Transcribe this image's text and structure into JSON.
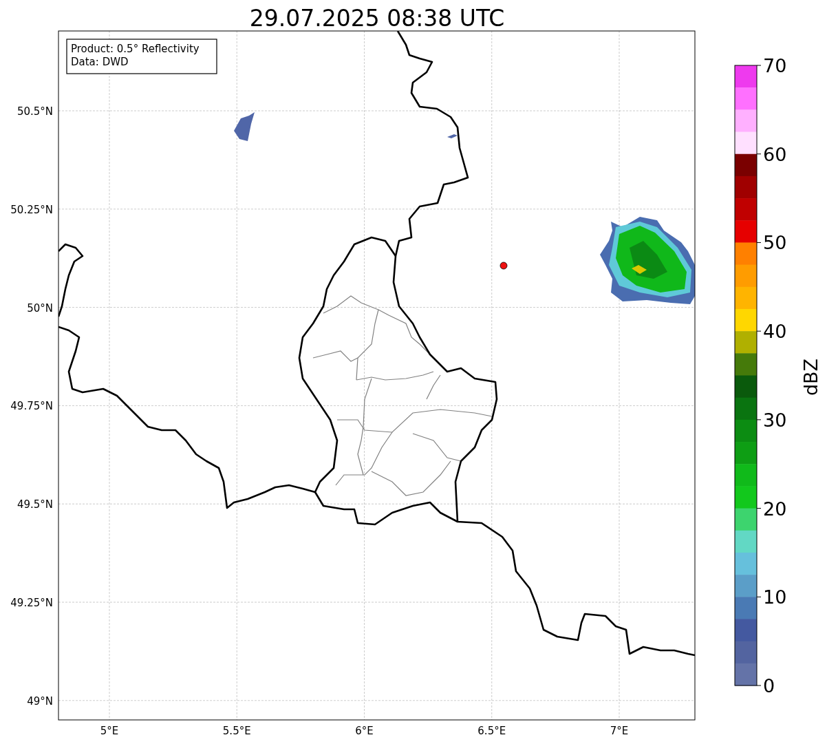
{
  "title": "29.07.2025 08:38 UTC",
  "map": {
    "legend": [
      "Product: 0.5° Reflectivity",
      "Data: DWD"
    ],
    "lat_labels": [
      "50.5°N",
      "50.25°N",
      "50°N",
      "49.75°N",
      "49.5°N",
      "49.25°N",
      "49°N"
    ],
    "lon_labels": [
      "5°E",
      "5.5°E",
      "6°E",
      "6.5°E",
      "7°E"
    ]
  },
  "colorbar": {
    "label": "dBZ",
    "ticks": [
      "70",
      "60",
      "50",
      "40",
      "30",
      "20",
      "10",
      "0"
    ],
    "bins": [
      {
        "color": "#ee3aee"
      },
      {
        "color": "#ff70ff"
      },
      {
        "color": "#ffb0ff"
      },
      {
        "color": "#ffe0ff"
      },
      {
        "color": "#7a0000"
      },
      {
        "color": "#a00000"
      },
      {
        "color": "#c00000"
      },
      {
        "color": "#e60000"
      },
      {
        "color": "#ff8000"
      },
      {
        "color": "#ff9c00"
      },
      {
        "color": "#ffb400"
      },
      {
        "color": "#ffd700"
      },
      {
        "color": "#b0b000"
      },
      {
        "color": "#457a0a"
      },
      {
        "color": "#0a5a0c"
      },
      {
        "color": "#0a7410"
      },
      {
        "color": "#0c8c12"
      },
      {
        "color": "#0e9e14"
      },
      {
        "color": "#10ba1a"
      },
      {
        "color": "#12c81c"
      },
      {
        "color": "#3dd46e"
      },
      {
        "color": "#62d8c4"
      },
      {
        "color": "#66c0dc"
      },
      {
        "color": "#5b9ec8"
      },
      {
        "color": "#4a7ab4"
      },
      {
        "color": "#4459a0"
      },
      {
        "color": "#5364a0"
      },
      {
        "color": "#6473a8"
      }
    ]
  }
}
